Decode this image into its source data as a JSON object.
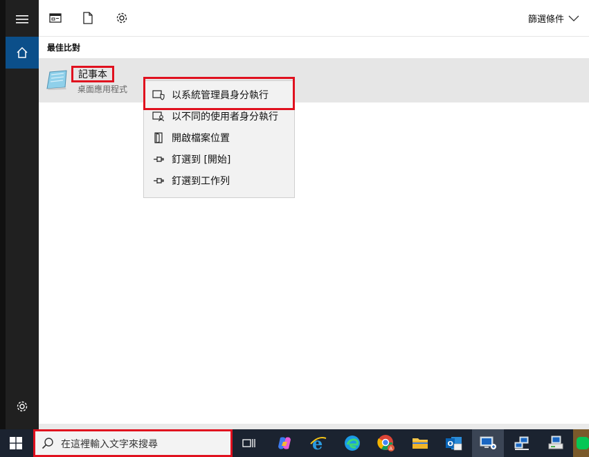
{
  "rail": {
    "icons": [
      "hamburger-icon",
      "home-icon",
      "settings-icon"
    ]
  },
  "toolbar": {
    "icons": [
      "all-results-icon",
      "documents-icon",
      "settings-icon"
    ],
    "filter_label": "篩選條件"
  },
  "results": {
    "section_title": "最佳比對",
    "best_match": {
      "name": "記事本",
      "subtitle": "桌面應用程式"
    }
  },
  "context_menu": {
    "items": [
      {
        "label": "以系統管理員身分執行",
        "icon": "admin-shield-icon"
      },
      {
        "label": "以不同的使用者身分執行",
        "icon": "user-icon"
      },
      {
        "label": "開啟檔案位置",
        "icon": "file-location-icon"
      },
      {
        "label": "釘選到 [開始]",
        "icon": "pin-icon"
      },
      {
        "label": "釘選到工作列",
        "icon": "pin-icon"
      }
    ]
  },
  "taskbar": {
    "search_placeholder": "在這裡輸入文字來搜尋",
    "apps": [
      "start-button",
      "task-view",
      "copilot",
      "internet-explorer",
      "edge",
      "chrome",
      "file-explorer",
      "outlook",
      "remote-desktop",
      "network-admin",
      "printer-admin",
      "line"
    ]
  }
}
